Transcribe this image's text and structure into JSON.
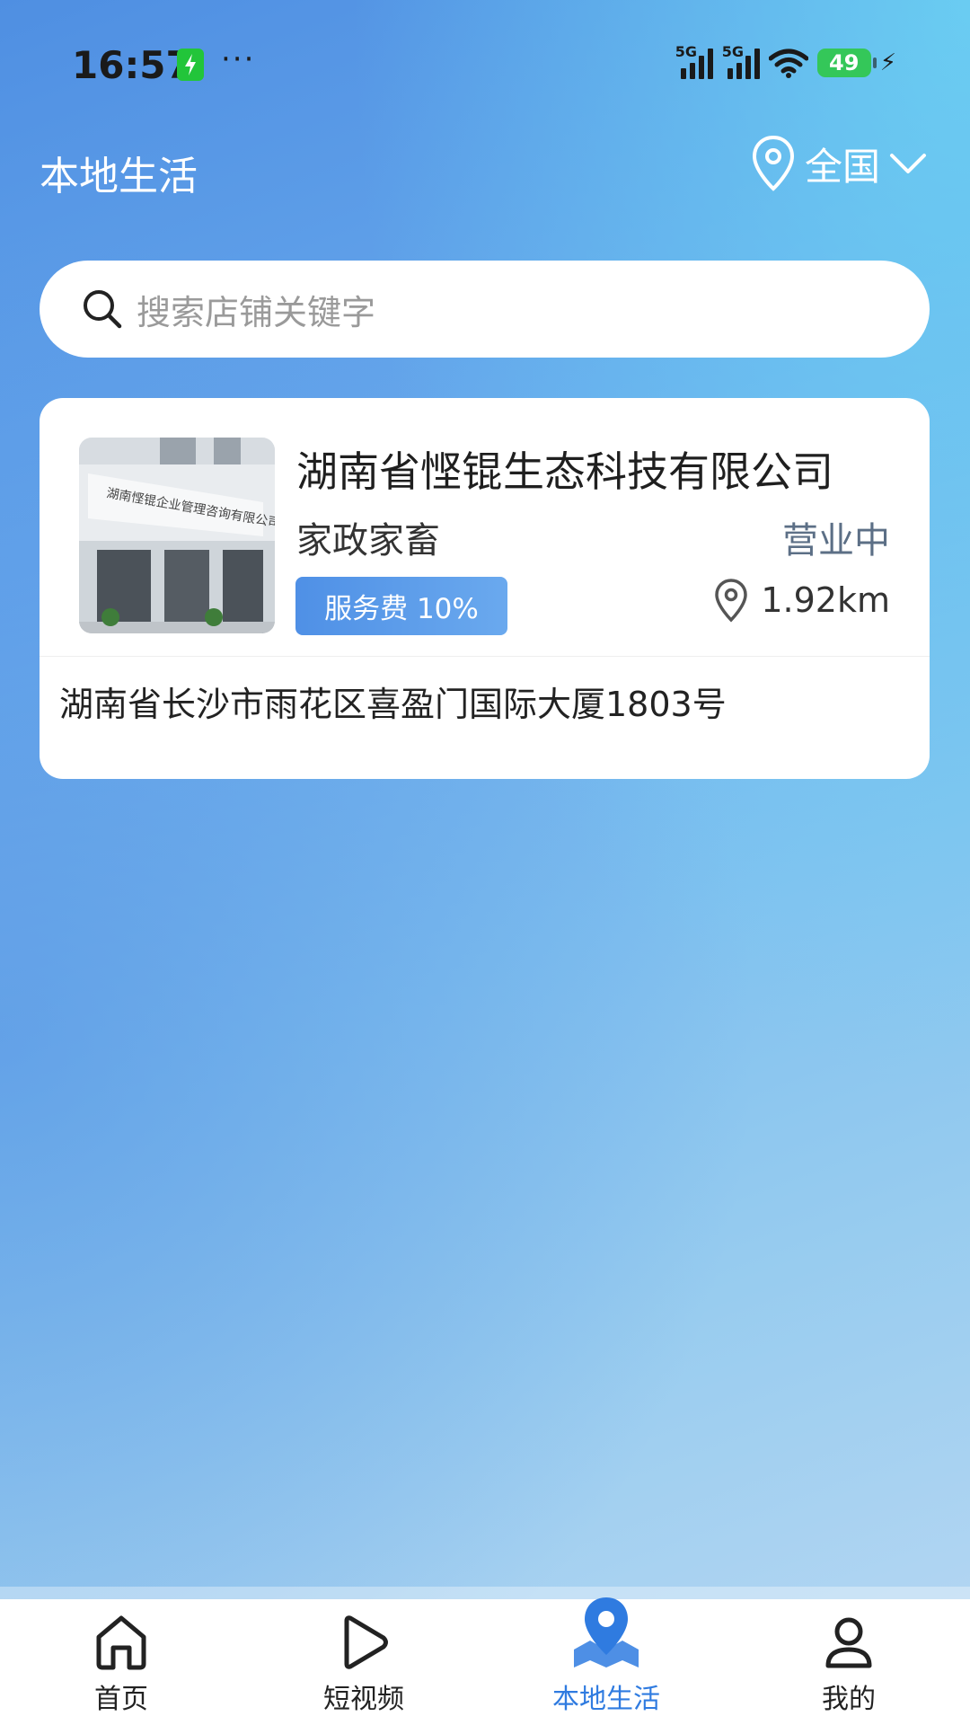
{
  "status_bar": {
    "time": "16:57",
    "dots": "···",
    "network_1": "5G",
    "network_2": "5G",
    "battery_level": "49"
  },
  "header": {
    "title": "本地生活",
    "location": "全国"
  },
  "search": {
    "placeholder": "搜索店铺关键字"
  },
  "shop": {
    "name": "湖南省悭锟生态科技有限公司",
    "category": "家政家畜",
    "status": "营业中",
    "fee_label": "服务费 10%",
    "distance": "1.92km",
    "address": "湖南省长沙市雨花区喜盈门国际大厦1803号",
    "photo_sign_text": "湖南悭锟企业管理咨询有限公司"
  },
  "bottom_nav": {
    "items": [
      {
        "label": "首页",
        "icon": "home-icon",
        "active": false
      },
      {
        "label": "短视频",
        "icon": "play-icon",
        "active": false
      },
      {
        "label": "本地生活",
        "icon": "map-pin-icon",
        "active": true
      },
      {
        "label": "我的",
        "icon": "user-icon",
        "active": false
      }
    ]
  },
  "colors": {
    "accent": "#2f7be0",
    "badge_gradient_start": "#4f90e6",
    "status_text": "#5c6f86"
  }
}
